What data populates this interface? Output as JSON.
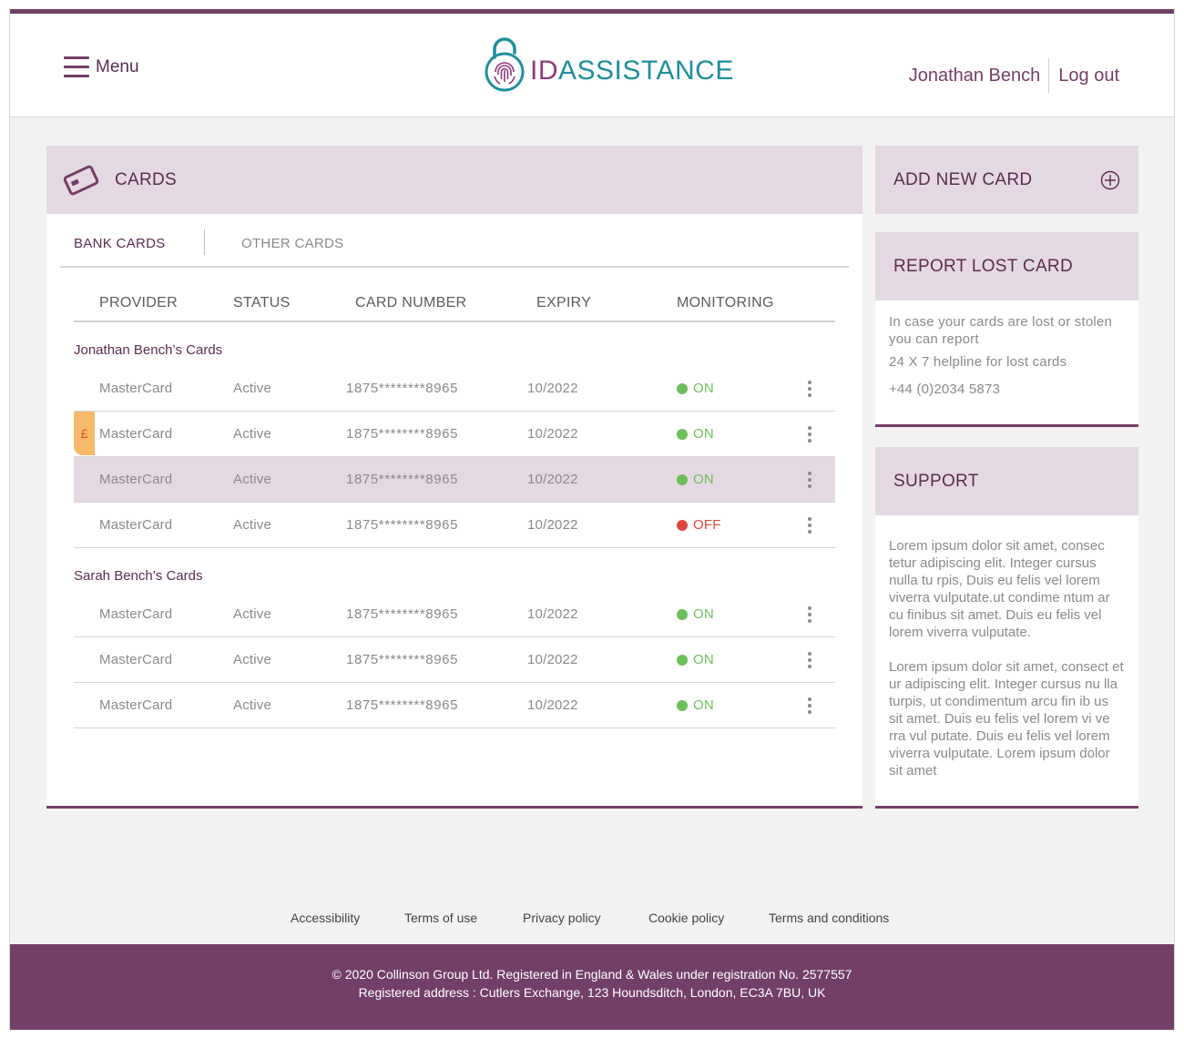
{
  "header": {
    "menu_label": "Menu",
    "logo": {
      "id_text": "ID",
      "rest_text": "ASSISTANCE",
      "id_color": "#8e3a7b",
      "rest_color": "#1f8f9c"
    },
    "user_name": "Jonathan Bench",
    "logout_label": "Log out"
  },
  "cards": {
    "title": "CARDS",
    "tabs": [
      {
        "label": "BANK CARDS",
        "active": true
      },
      {
        "label": "OTHER CARDS",
        "active": false
      }
    ],
    "columns": [
      "PROVIDER",
      "STATUS",
      "CARD NUMBER",
      "EXPIRY",
      "MONITORING"
    ],
    "groups": [
      {
        "label": "Jonathan Bench’s Cards",
        "rows": [
          {
            "provider": "MasterCard",
            "status": "Active",
            "number": "1875********8965",
            "expiry": "10/2022",
            "monitoring": "ON"
          },
          {
            "provider": "MasterCard",
            "status": "Active",
            "number": "1875********8965",
            "expiry": "10/2022",
            "monitoring": "ON",
            "flag": "£"
          },
          {
            "provider": "MasterCard",
            "status": "Active",
            "number": "1875********8965",
            "expiry": "10/2022",
            "monitoring": "ON",
            "highlighted": true
          },
          {
            "provider": "MasterCard",
            "status": "Active",
            "number": "1875********8965",
            "expiry": "10/2022",
            "monitoring": "OFF"
          }
        ]
      },
      {
        "label": "Sarah Bench’s Cards",
        "rows": [
          {
            "provider": "MasterCard",
            "status": "Active",
            "number": "1875********8965",
            "expiry": "10/2022",
            "monitoring": "ON"
          },
          {
            "provider": "MasterCard",
            "status": "Active",
            "number": "1875********8965",
            "expiry": "10/2022",
            "monitoring": "ON"
          },
          {
            "provider": "MasterCard",
            "status": "Active",
            "number": "1875********8965",
            "expiry": "10/2022",
            "monitoring": "ON"
          }
        ]
      }
    ]
  },
  "add_card": {
    "label": "ADD NEW CARD"
  },
  "report_lost": {
    "title": "REPORT LOST CARD",
    "text1": "In case your cards are lost or stolen you can report",
    "text2": "24 X 7 helpline for lost cards",
    "phone": "+44  (0)2034 5873"
  },
  "support": {
    "title": "SUPPORT",
    "para1": "Lorem ipsum dolor sit amet, consec tetur adipiscing elit. Integer cursus nulla tu rpis,  Duis eu felis vel lorem viverra vulputate.ut condime ntum ar cu finibus sit amet. Duis eu felis vel lorem viverra vulputate.",
    "para2": "Lorem ipsum dolor sit amet, consect et ur adipiscing elit. Integer cursus nu lla turpis, ut condimentum arcu fin ib us sit amet. Duis eu felis vel lorem vi ve rra vul putate.  Duis eu felis vel lorem viverra vulputate. Lorem ipsum dolor sit amet"
  },
  "footer": {
    "links": [
      "Accessibility",
      "Terms of use",
      "Privacy policy",
      "Cookie policy",
      "Terms and conditions"
    ],
    "copyright": "© 2020 Collinson Group Ltd. Registered in England & Wales under registration No. 2577557",
    "address": "Registered address : Cutlers Exchange, 123 Houndsditch, London, EC3A 7BU, UK"
  },
  "colors": {
    "brand": "#733f67",
    "panel_tint": "#e4d9e2",
    "status_on": "#6cbf5a",
    "status_off": "#e0463d",
    "flag": "#f7b96a"
  }
}
